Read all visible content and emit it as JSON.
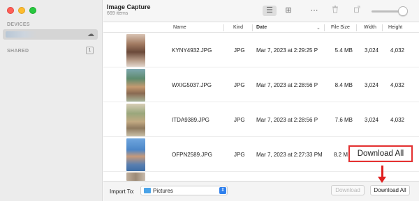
{
  "window": {
    "title": "Image Capture",
    "subtitle": "669 items"
  },
  "sidebar": {
    "devices_label": "DEVICES",
    "shared_label": "SHARED",
    "shared_count": "1",
    "device_icon": "cloud-icon"
  },
  "toolbar": {
    "icons": [
      "list-view-icon",
      "grid-view-icon",
      "more-icon",
      "trash-icon",
      "rotate-icon",
      "thumbnail-size-slider"
    ],
    "list_view_glyph": "☰",
    "grid_view_glyph": "⊞",
    "more_glyph": "⋯",
    "trash_glyph": "🗑",
    "rotate_glyph": "↺"
  },
  "table": {
    "columns": {
      "name": "Name",
      "kind": "Kind",
      "date": "Date",
      "file_size": "File Size",
      "width": "Width",
      "height": "Height"
    },
    "sort_indicator": "⌄",
    "rows": [
      {
        "name": "KYNY4932.JPG",
        "kind": "JPG",
        "date": "Mar 7, 2023 at 2:29:25 P",
        "size": "5.4 MB",
        "width": "3,024",
        "height": "4,032"
      },
      {
        "name": "WXIG5037.JPG",
        "kind": "JPG",
        "date": "Mar 7, 2023 at 2:28:56 P",
        "size": "8.4 MB",
        "width": "3,024",
        "height": "4,032"
      },
      {
        "name": "ITDA9389.JPG",
        "kind": "JPG",
        "date": "Mar 7, 2023 at 2:28:56 P",
        "size": "7.6 MB",
        "width": "3,024",
        "height": "4,032"
      },
      {
        "name": "OFPN2589.JPG",
        "kind": "JPG",
        "date": "Mar 7, 2023 at 2:27:33 PM",
        "size": "8.2 M",
        "width": "",
        "height": ""
      }
    ]
  },
  "bottom_bar": {
    "import_to_label": "Import To:",
    "import_destination": "Pictures",
    "download_label": "Download",
    "download_all_label": "Download All"
  },
  "annotation": {
    "callout_text": "Download All",
    "color": "#e53030"
  }
}
